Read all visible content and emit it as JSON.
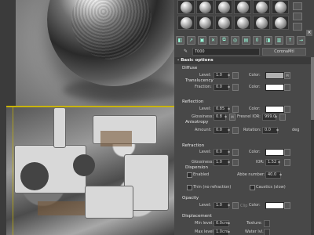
{
  "toolbar": {
    "material_name": "T000",
    "material_type": "CoronaMtl"
  },
  "rollout": {
    "title": "Basic options"
  },
  "diffuse": {
    "title": "Diffuse",
    "level_label": "Level:",
    "level_value": "1.0",
    "color_label": "Color:",
    "color": "#b0b0b0",
    "map_btn": "M",
    "translucency_title": "Translucency",
    "fraction_label": "Fraction:",
    "fraction_value": "0.0",
    "trans_color_label": "Color:"
  },
  "reflection": {
    "title": "Reflection",
    "level_label": "Level:",
    "level_value": "0.85",
    "color_label": "Color:",
    "glossiness_label": "Glossiness:",
    "glossiness_value": "0.8",
    "map_btn": "M",
    "fresnel_label": "Fresnel IOR:",
    "fresnel_value": "999.0",
    "anisotropy_title": "Anisotropy",
    "amount_label": "Amount:",
    "amount_value": "0.0",
    "rotation_label": "Rotation:",
    "rotation_value": "0.0",
    "deg": "deg"
  },
  "refraction": {
    "title": "Refraction",
    "level_label": "Level:",
    "level_value": "0.0",
    "color_label": "Color:",
    "glossiness_label": "Glossiness:",
    "glossiness_value": "1.0",
    "ior_label": "IOR:",
    "ior_value": "1.52",
    "dispersion_title": "Dispersion",
    "enabled_label": "Enabled",
    "abbe_label": "Abbe number:",
    "abbe_value": "40.0",
    "thin_label": "Thin (no refraction)",
    "caustics_label": "Caustics (slow)"
  },
  "opacity": {
    "title": "Opacity",
    "level_label": "Level:",
    "level_value": "1.0",
    "clip_label": "Clip",
    "color_label": "Color:"
  },
  "displacement": {
    "title": "Displacement",
    "min_label": "Min level:",
    "min_value": "0.0",
    "min_unit": "cm",
    "texture_label": "Texture:",
    "max_label": "Max level:",
    "max_value": "1.0",
    "max_unit": "cm",
    "water_label": "Water lvl.:"
  },
  "colors": {
    "white": "#ffffff",
    "gray_swatch": "#b0b0b0"
  }
}
